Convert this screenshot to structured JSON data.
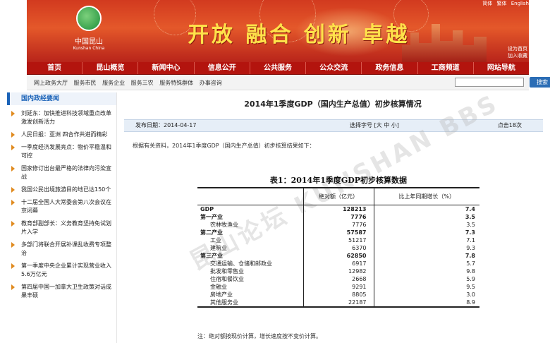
{
  "header": {
    "logo_cn": "中国昆山",
    "logo_en": "Kunshan China",
    "slogan": "开放 融合 创新 卓越",
    "top_links": [
      "简体",
      "繁体",
      "English"
    ],
    "side_links": [
      "设为首页",
      "加入收藏"
    ]
  },
  "nav": [
    "首页",
    "昆山概览",
    "新闻中心",
    "信息公开",
    "公共服务",
    "公众交流",
    "政务信息",
    "工商频道",
    "网站导航"
  ],
  "subnav": {
    "links": [
      "网上政务大厅",
      "服务市民",
      "服务企业",
      "服务三农",
      "服务特殊群体",
      "办事咨询"
    ],
    "search_button": "搜索"
  },
  "sidebar": {
    "title": "国内政经要闻",
    "items": [
      "刘延东：加快推进科技领域重点改革 激发创新活力",
      "人民日报：亚洲 四合作共进而精彩",
      "一季度经济发展亮点：物价平稳温和可控",
      "国家修订出台最严格的法律向污染宣战",
      "我国公民出境旅游目的地已达150个",
      "十二届全国人大常委会第八次会议在京闭幕",
      "教育部副部长：义务教育坚持免试划片入学",
      "多部门将联合开展补课乱收费专项整治",
      "第一季度中央企业累计实现营业收入5.6万亿元",
      "第四届中国一加拿大卫生政策对话成果丰硕"
    ]
  },
  "article": {
    "title": "2014年1季度GDP（国内生产总值）初步核算情况",
    "date_label": "发布日期：2014-04-17",
    "font_label": "选择字号 [大 中 小]",
    "hits_label": "点击18次",
    "intro": "根据有关资料，2014年1季度GDP（国内生产总值）初步核算结果如下：",
    "watermark": "昆山论坛 KUNSHAN BBS"
  },
  "table": {
    "caption": "表1：2014年1季度GDP初步核算数据",
    "headers": [
      "",
      "绝对额（亿元）",
      "比上年同期增长（%）"
    ],
    "rows": [
      {
        "name": "GDP",
        "value": "128213",
        "growth": "7.4",
        "bold": true,
        "sub": false
      },
      {
        "name": "第一产业",
        "value": "7776",
        "growth": "3.5",
        "bold": true,
        "sub": false
      },
      {
        "name": "农林牧渔业",
        "value": "7776",
        "growth": "3.5",
        "bold": false,
        "sub": true
      },
      {
        "name": "第二产业",
        "value": "57587",
        "growth": "7.3",
        "bold": true,
        "sub": false
      },
      {
        "name": "工业",
        "value": "51217",
        "growth": "7.1",
        "bold": false,
        "sub": true
      },
      {
        "name": "建筑业",
        "value": "6370",
        "growth": "9.3",
        "bold": false,
        "sub": true
      },
      {
        "name": "第三产业",
        "value": "62850",
        "growth": "7.8",
        "bold": true,
        "sub": false
      },
      {
        "name": "交通运输、仓储和邮政业",
        "value": "6917",
        "growth": "5.7",
        "bold": false,
        "sub": true
      },
      {
        "name": "批发和零售业",
        "value": "12982",
        "growth": "9.8",
        "bold": false,
        "sub": true
      },
      {
        "name": "住宿和餐饮业",
        "value": "2668",
        "growth": "5.9",
        "bold": false,
        "sub": true
      },
      {
        "name": "金融业",
        "value": "9291",
        "growth": "9.5",
        "bold": false,
        "sub": true
      },
      {
        "name": "房地产业",
        "value": "8805",
        "growth": "3.0",
        "bold": false,
        "sub": true
      },
      {
        "name": "其他服务业",
        "value": "22187",
        "growth": "8.9",
        "bold": false,
        "sub": true
      }
    ],
    "note": "注：绝对额按现价计算，增长速度按不变价计算。"
  },
  "colors": {
    "nav_bg": "#b3140e",
    "banner_text": "#ffe24a",
    "accent_blue": "#1b63b8"
  }
}
